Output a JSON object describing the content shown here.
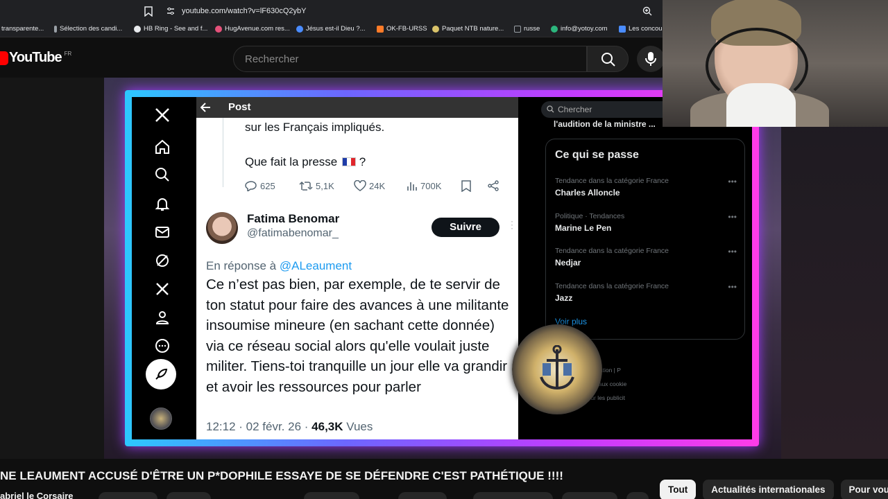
{
  "browser": {
    "url": "youtube.com/watch?v=lF630cQ2ybY",
    "bookmarks": [
      {
        "label": "transparente...",
        "color": "#5f6368"
      },
      {
        "label": "Sélection des candi...",
        "color": "#9aa0a6"
      },
      {
        "label": "HB Ring - See and f...",
        "color": "#e8eaed"
      },
      {
        "label": "HugAvenue.com res...",
        "color": "#e5517a"
      },
      {
        "label": "Jésus est-il Dieu ?...",
        "color": "#4a8cff"
      },
      {
        "label": "OK-FB-URSS",
        "color": "#ff7b28"
      },
      {
        "label": "Paquet NTB nature...",
        "color": "#d9c36a"
      },
      {
        "label": "russe",
        "color": "#9aa0a6"
      },
      {
        "label": "info@yotoy.com",
        "color": "#2cb67d"
      },
      {
        "label": "Les concours",
        "color": "#4a8cff"
      }
    ]
  },
  "youtube": {
    "logo": "YouTube",
    "country": "FR",
    "search_placeholder": "Rechercher",
    "video_title": "NE LEAUMENT ACCUSÉ D'ÊTRE UN P*DOPHILE ESSAYE DE SE DÉFENDRE C'EST PATHÉTIQUE !!!!",
    "channel": "abriel le Corsaire",
    "chips": [
      "Tout",
      "Actualités internationales",
      "Pour vous"
    ]
  },
  "xpost": {
    "header_title": "Post",
    "prev_text": "sur les Français impliqués.",
    "prev_question": "Que fait la presse",
    "prev_question_end": "?",
    "stats": {
      "replies": "625",
      "reposts": "5,1K",
      "likes": "24K",
      "views": "700K"
    },
    "author_name": "Fatima Benomar",
    "author_handle": "@fatimabenomar_",
    "follow_label": "Suivre",
    "in_reply_prefix": "En réponse à",
    "in_reply_mention": "@ALeaument",
    "body": "Ce n’est pas bien, par exemple, de te servir de ton statut pour faire des avances à une militante insoumise mineure (en sachant cette donnée) via ce réseau social alors qu'elle voulait juste militer. Tiens-toi tranquille un jour elle va grandir et avoir les ressources pour parler",
    "time": "12:12 · 02 févr. 26 ·",
    "views_count": "46,3K",
    "views_label": "Vues"
  },
  "xsidebar": {
    "search_placeholder": "Chercher",
    "snippet": "l'audition de la ministre ...",
    "trends_title": "Ce qui se passe",
    "trends": [
      {
        "category": "Tendance dans la catégorie France",
        "name": "Charles Alloncle"
      },
      {
        "category": "Politique · Tendances",
        "name": "Marine Le Pen"
      },
      {
        "category": "Tendance dans la catégorie France",
        "name": "Nedjar"
      },
      {
        "category": "Tendance dans la catégorie France",
        "name": "Jazz"
      }
    ],
    "see_more": "Voir plus",
    "footer_lines": [
      "Conditions d'utilisation   |   P",
      "Politique relative aux cookie",
      "Informations sur les publicit"
    ]
  },
  "colors": {
    "neon_start": "#2cc8ff",
    "neon_end": "#ff3ce8",
    "yt_red": "#ff0000",
    "x_blue": "#1d9bf0"
  }
}
